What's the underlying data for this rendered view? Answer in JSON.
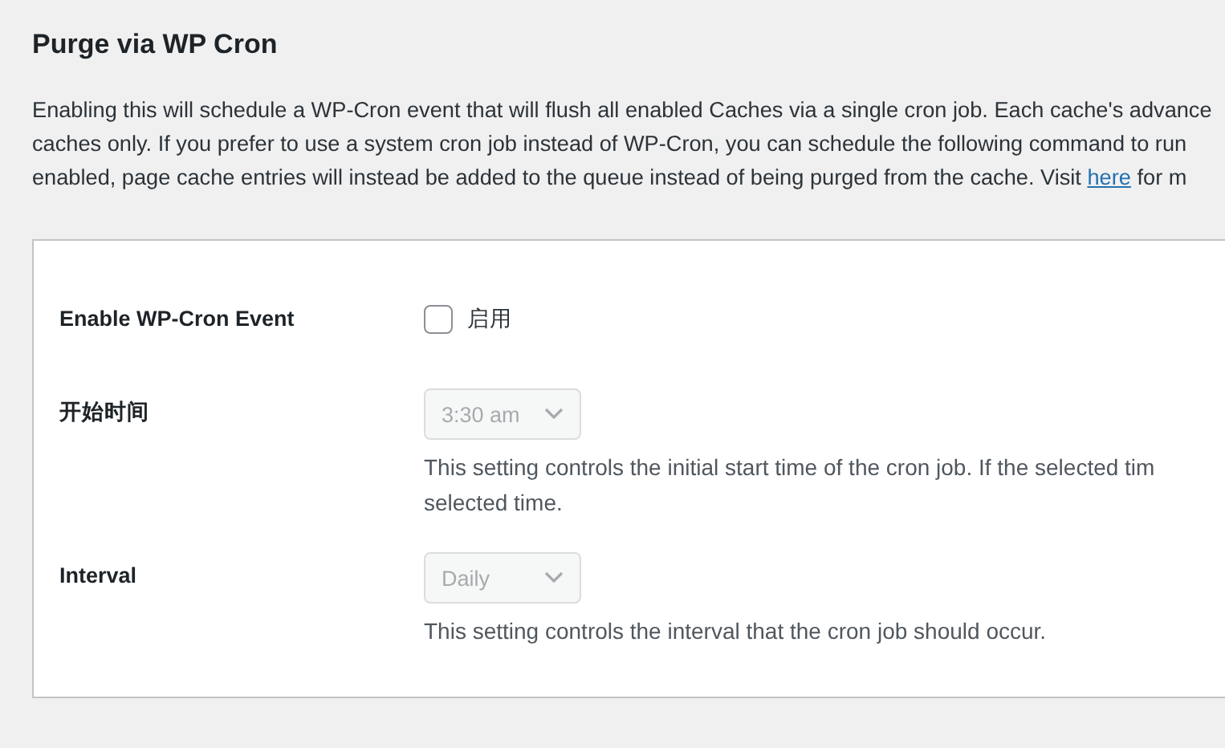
{
  "heading": "Purge via WP Cron",
  "intro": {
    "lines": [
      "Enabling this will schedule a WP-Cron event that will flush all enabled Caches via a single cron job. Each cache's advance",
      "caches only. If you prefer to use a system cron job instead of WP-Cron, you can schedule the following command to run"
    ],
    "last_before": "enabled, page cache entries will instead be added to the queue instead of being purged from the cache. Visit ",
    "link": "here",
    "last_after": " for m"
  },
  "settings": [
    {
      "kind": "checkbox",
      "label": "Enable WP-Cron Event",
      "checked": false,
      "option": "启用"
    },
    {
      "kind": "select",
      "label": "开始时间",
      "value": "3:30 am",
      "disabled": true,
      "description": [
        "This setting controls the initial start time of the cron job. If the selected tim",
        "selected time."
      ]
    },
    {
      "kind": "select",
      "label": "Interval",
      "value": "Daily",
      "disabled": true,
      "description": [
        "This setting controls the interval that the cron job should occur."
      ]
    }
  ]
}
